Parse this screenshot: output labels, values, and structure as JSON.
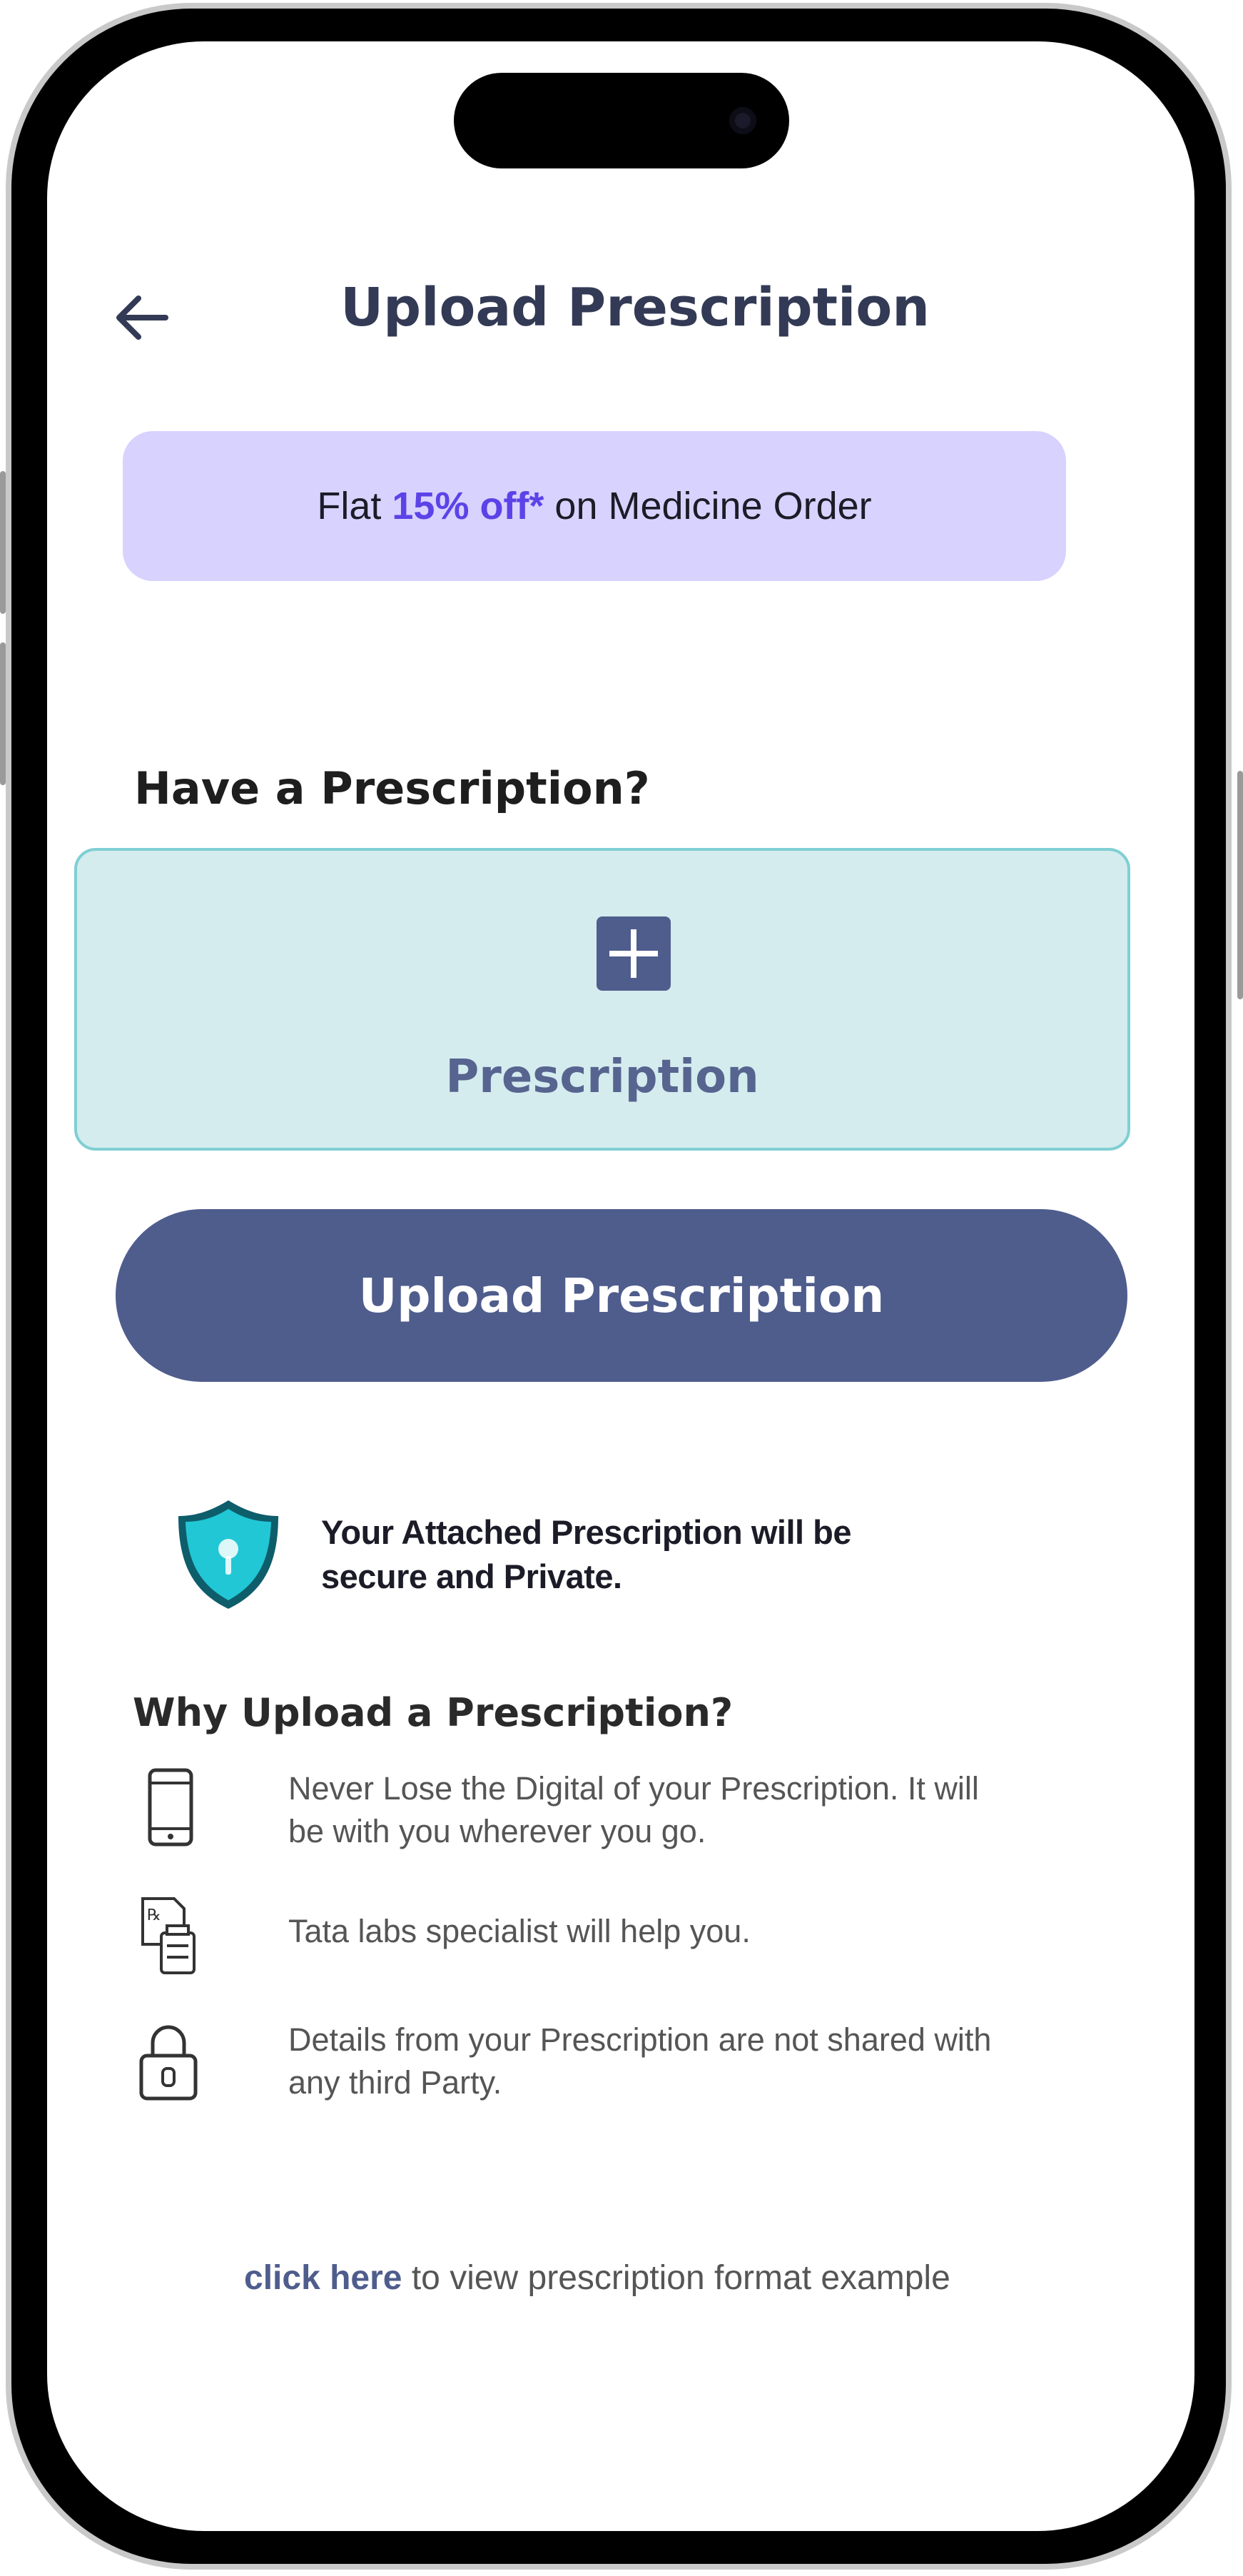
{
  "header": {
    "title": "Upload Prescription",
    "back_icon": "arrow-left-icon"
  },
  "offer": {
    "prefix": "Flat ",
    "highlight": "15% off*",
    "suffix": " on Medicine Order",
    "accent_color": "#5b43e8",
    "background_color": "#d8d2ff"
  },
  "section": {
    "title": "Have a Prescription?"
  },
  "dropzone": {
    "label": "Prescription",
    "icon": "plus-icon"
  },
  "primary_button": {
    "label": "Upload Prescription",
    "color": "#4f5d8d"
  },
  "secure_note": {
    "line1": "Your Attached Prescription will be",
    "line2": "secure and Private.",
    "icon": "shield-icon"
  },
  "why": {
    "title": "Why Upload a Prescription?",
    "items": [
      {
        "icon": "phone-icon",
        "line1": "Never Lose the Digital of your Prescription. It will",
        "line2": "be with you wherever you go."
      },
      {
        "icon": "prescription-icon",
        "line1": "Tata labs specialist will help you.",
        "line2": ""
      },
      {
        "icon": "lock-icon",
        "line1": "Details from your Prescription are not shared with",
        "line2": "any third Party."
      }
    ]
  },
  "footer": {
    "link_text": "click here",
    "rest_text": " to view prescription format example"
  }
}
